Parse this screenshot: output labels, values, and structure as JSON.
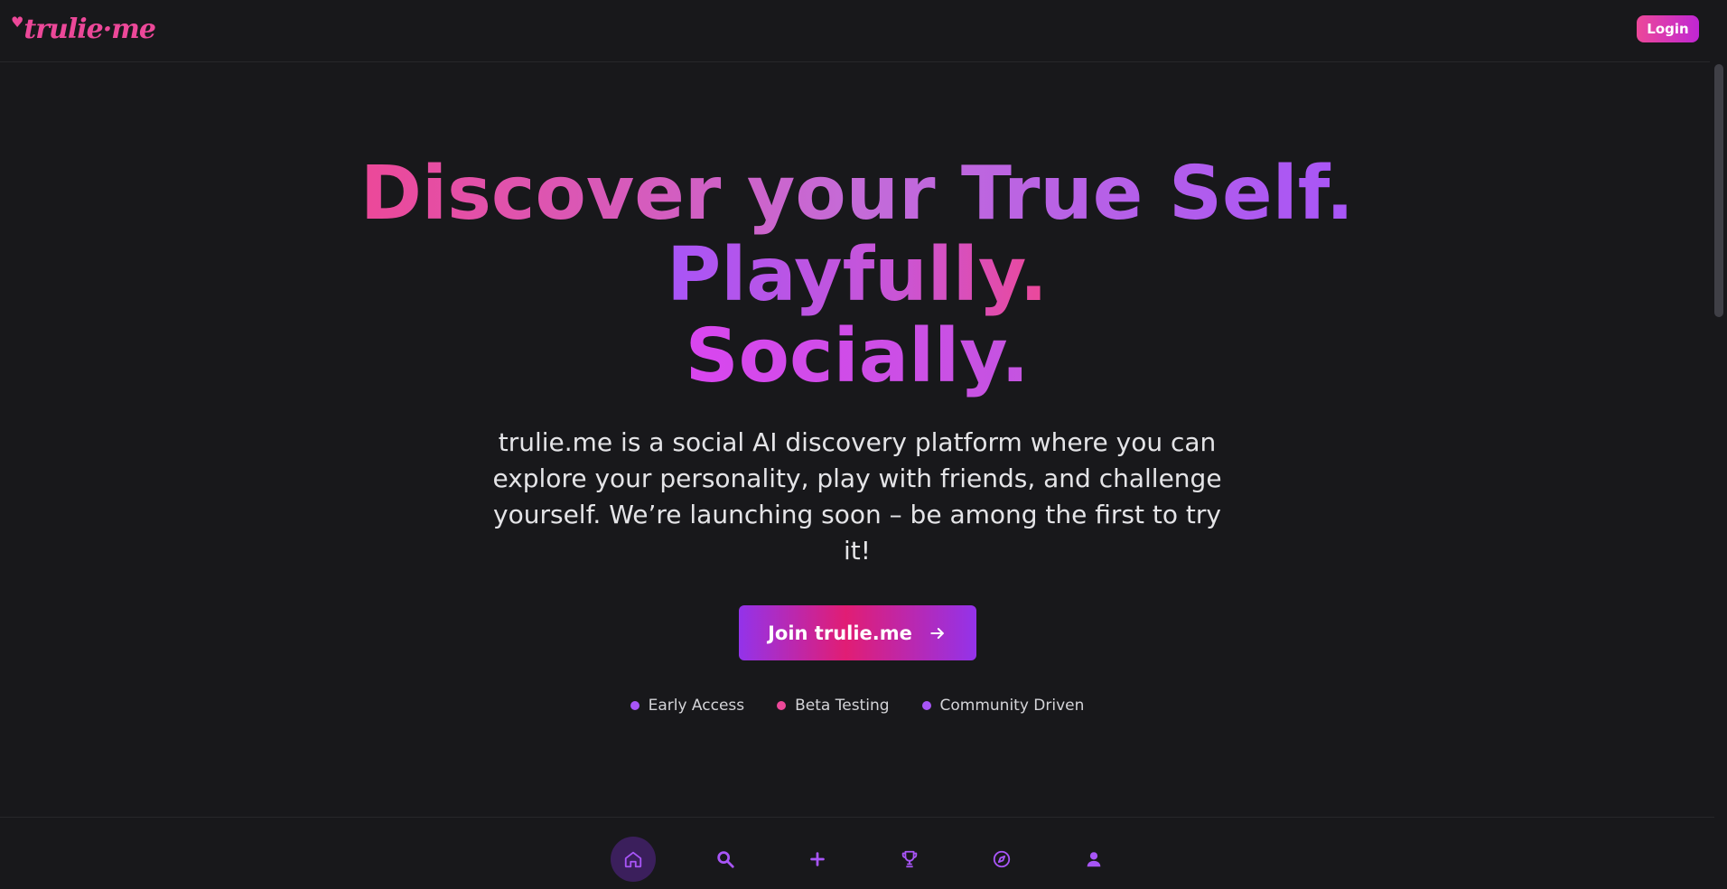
{
  "header": {
    "logo_text": "trulie·me",
    "login_label": "Login"
  },
  "hero": {
    "headline_line1": "Discover your True Self.",
    "headline_line2": "Playfully.",
    "headline_line3": "Socially.",
    "description": "trulie.me is a social AI discovery platform where you can explore your personality, play with friends, and challenge yourself. We’re launching soon – be among the first to try it!",
    "cta_label": "Join trulie.me",
    "cta_icon": "arrow-right-icon"
  },
  "badges": [
    {
      "label": "Early Access",
      "color": "#a855f7"
    },
    {
      "label": "Beta Testing",
      "color": "#ec4899"
    },
    {
      "label": "Community Driven",
      "color": "#a855f7"
    }
  ],
  "bottom_nav": {
    "items": [
      {
        "icon": "home-icon",
        "active": true
      },
      {
        "icon": "search-icon",
        "active": false
      },
      {
        "icon": "plus-icon",
        "active": false
      },
      {
        "icon": "trophy-icon",
        "active": false
      },
      {
        "icon": "compass-icon",
        "active": false
      },
      {
        "icon": "user-icon",
        "active": false
      }
    ]
  },
  "colors": {
    "background": "#18181b",
    "accent_pink": "#ec4899",
    "accent_purple": "#a855f7"
  }
}
